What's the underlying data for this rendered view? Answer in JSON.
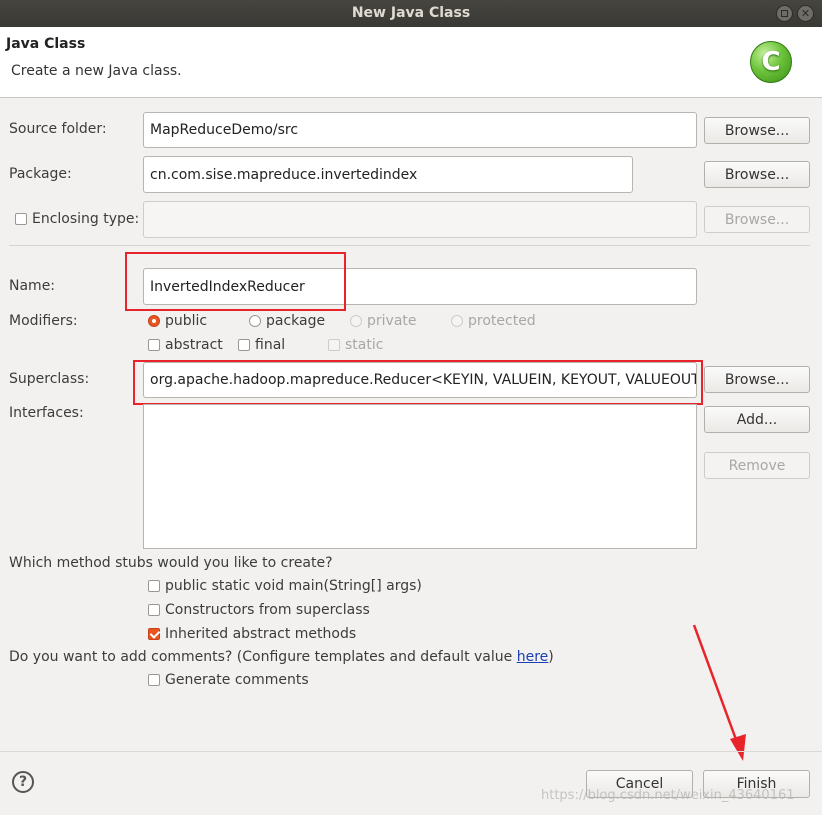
{
  "window": {
    "title": "New Java Class"
  },
  "banner": {
    "title": "Java Class",
    "subtitle": "Create a new Java class.",
    "logo_letter": "C"
  },
  "source_folder": {
    "label": "Source folder:",
    "value": "MapReduceDemo/src",
    "browse": "Browse..."
  },
  "package": {
    "label": "Package:",
    "value": "cn.com.sise.mapreduce.invertedindex",
    "browse": "Browse..."
  },
  "enclosing": {
    "label": "Enclosing type:",
    "value": "",
    "browse": "Browse..."
  },
  "name": {
    "label": "Name:",
    "value": "InvertedIndexReducer"
  },
  "modifiers": {
    "label": "Modifiers:",
    "public": "public",
    "package": "package",
    "private": "private",
    "protected": "protected",
    "abstract": "abstract",
    "final": "final",
    "static": "static"
  },
  "superclass": {
    "label": "Superclass:",
    "value": "org.apache.hadoop.mapreduce.Reducer<KEYIN, VALUEIN, KEYOUT, VALUEOUT>",
    "browse": "Browse..."
  },
  "interfaces": {
    "label": "Interfaces:",
    "add": "Add...",
    "remove": "Remove"
  },
  "stubs": {
    "question": "Which method stubs would you like to create?",
    "main": "public static void main(String[] args)",
    "constructors": "Constructors from superclass",
    "inherited": "Inherited abstract methods"
  },
  "comments": {
    "question_prefix": "Do you want to add comments? (Configure templates and default value ",
    "link": "here",
    "question_suffix": ")",
    "generate": "Generate comments"
  },
  "footer": {
    "help": "?",
    "cancel": "Cancel",
    "finish": "Finish",
    "watermark": "https://blog.csdn.net/weixin_43640161"
  },
  "colors": {
    "accent": "#e95420",
    "annotation": "#e8242a",
    "logo": "#6cc43a"
  }
}
